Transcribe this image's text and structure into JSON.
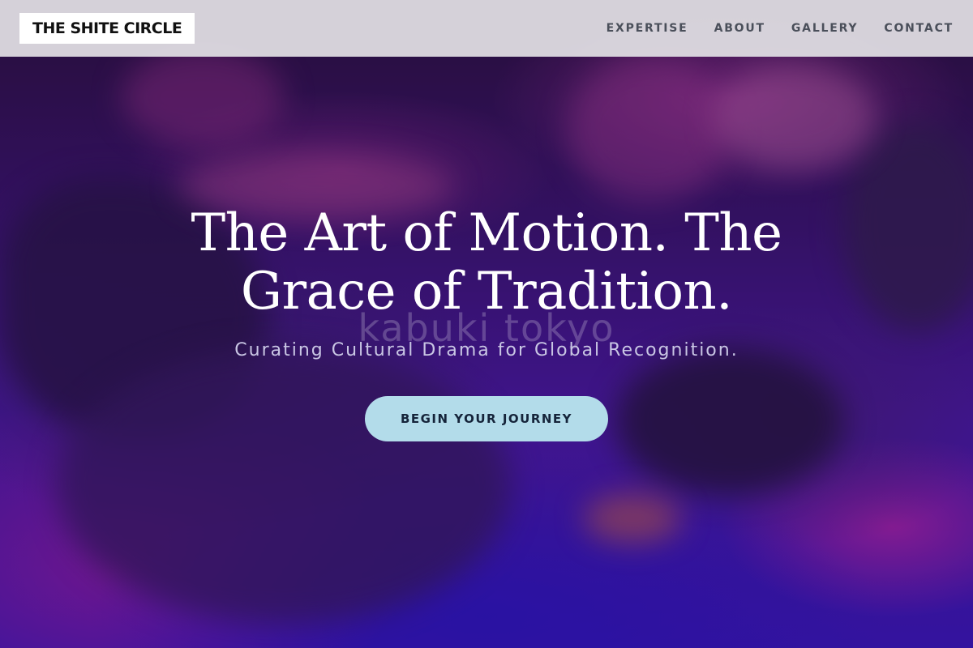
{
  "header": {
    "logo_text": "THE SHITE CIRCLE",
    "nav": [
      {
        "label": "EXPERTISE"
      },
      {
        "label": "ABOUT"
      },
      {
        "label": "GALLERY"
      },
      {
        "label": "CONTACT"
      }
    ]
  },
  "hero": {
    "title": "The Art of Motion. The Grace of Tradition.",
    "watermark": "kabuki tokyo",
    "subtitle": "Curating Cultural Drama for Global Recognition.",
    "cta_label": "BEGIN YOUR JOURNEY",
    "background_image": "dancers-on-floor-purple-magenta-lighting"
  },
  "colors": {
    "nav_bg": "#dedce2",
    "cta_bg": "#b3dcea",
    "hero_tint": "#3a16c0",
    "accent_magenta": "#d02aa0"
  }
}
